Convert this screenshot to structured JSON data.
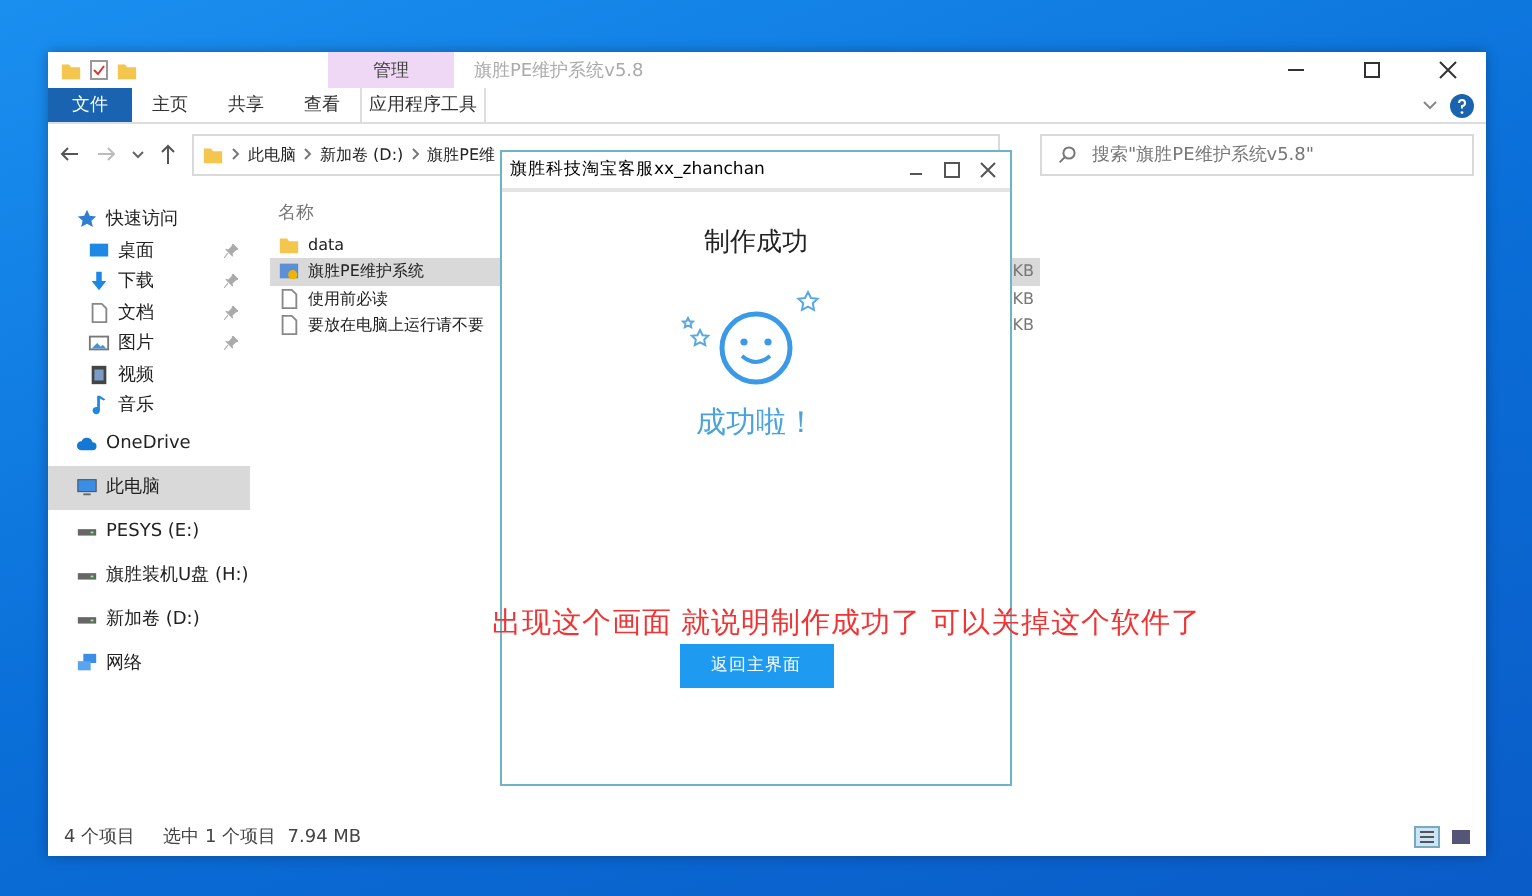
{
  "explorer": {
    "title": "旗胜PE维护系统v5.8",
    "context_tab": "管理",
    "ribbon_tabs": [
      {
        "label": "文件",
        "kind": "file",
        "selected": false
      },
      {
        "label": "主页",
        "kind": "tab",
        "selected": false
      },
      {
        "label": "共享",
        "kind": "tab",
        "selected": false
      },
      {
        "label": "查看",
        "kind": "tab",
        "selected": false
      },
      {
        "label": "应用程序工具",
        "kind": "context",
        "selected": false
      }
    ],
    "address": {
      "crumbs": [
        "此电脑",
        "新加卷 (D:)",
        "旗胜PE维"
      ]
    },
    "search": {
      "placeholder": "搜索\"旗胜PE维护系统v5.8\""
    },
    "nav": [
      {
        "label": "快速访问",
        "kind": "star",
        "selected": false,
        "children": [
          {
            "label": "桌面",
            "kind": "desktop",
            "pinned": true,
            "selected": false
          },
          {
            "label": "下载",
            "kind": "download",
            "pinned": true,
            "selected": false
          },
          {
            "label": "文档",
            "kind": "document",
            "pinned": true,
            "selected": false
          },
          {
            "label": "图片",
            "kind": "picture",
            "pinned": true,
            "selected": false
          },
          {
            "label": "视频",
            "kind": "video",
            "selected": false
          },
          {
            "label": "音乐",
            "kind": "music",
            "selected": false
          }
        ]
      },
      {
        "label": "OneDrive",
        "kind": "cloud",
        "selected": false
      },
      {
        "label": "此电脑",
        "kind": "pc",
        "selected": true
      },
      {
        "label": "PESYS (E:)",
        "kind": "drive",
        "selected": false
      },
      {
        "label": "旗胜装机U盘 (H:)",
        "kind": "drive",
        "selected": false
      },
      {
        "label": "新加卷 (D:)",
        "kind": "drive",
        "selected": false
      },
      {
        "label": "网络",
        "kind": "network",
        "selected": false
      }
    ],
    "list": {
      "column": "名称",
      "rows": [
        {
          "name": "data",
          "kind": "folder",
          "selected": false
        },
        {
          "name": "旗胜PE维护系统",
          "kind": "app",
          "size": "KB",
          "selected": true
        },
        {
          "name": "使用前必读",
          "kind": "doc",
          "size": "KB",
          "selected": false
        },
        {
          "name": "要放在电脑上运行请不要",
          "kind": "doc",
          "size": "KB",
          "selected": false
        }
      ]
    },
    "status": {
      "count": "4 个项目",
      "selection": "选中 1 个项目  7.94 MB"
    }
  },
  "dialog": {
    "title": "旗胜科技淘宝客服xx_zhanchan",
    "heading": "制作成功",
    "message": "成功啦！",
    "button": "返回主界面"
  },
  "annotation": "出现这个画面 就说明制作成功了 可以关掉这个软件了"
}
